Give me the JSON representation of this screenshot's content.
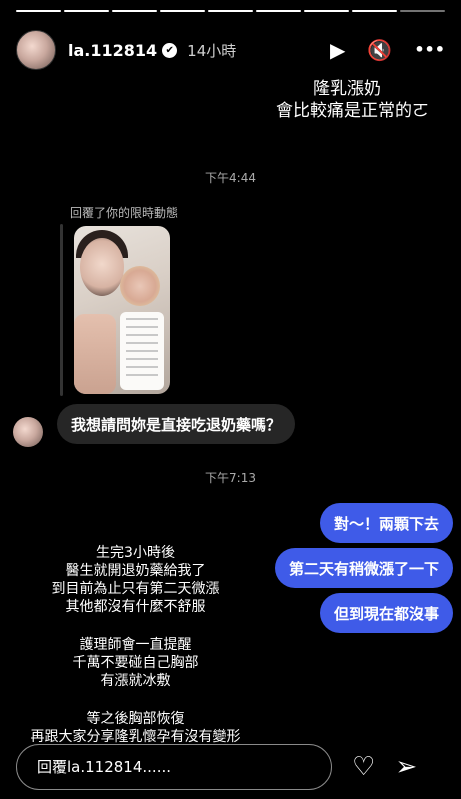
{
  "progress_segments": 9,
  "progress_done": 8,
  "header": {
    "username": "la.112814",
    "verified_glyph": "✔",
    "time": "14小時",
    "play_icon": "▶",
    "mute_icon": "🔇",
    "more_icon": "•••"
  },
  "story": {
    "top_line1": "隆乳漲奶",
    "top_line2": "會比較痛是正常的ㄛ",
    "timestamp1": "下午4:44",
    "reply_label": "回覆了你的限時動態",
    "gray_bubble": "我想請問妳是直接吃退奶藥嗎？",
    "timestamp2": "下午7:13",
    "blue_bubbles": [
      "對～！兩顆下去",
      "第二天有稍微漲了一下",
      "但到現在都沒事"
    ],
    "overlay_block1": [
      "生完3小時後",
      "醫生就開退奶藥給我了",
      "到目前為止只有第二天微漲",
      "其他都沒有什麼不舒服"
    ],
    "overlay_block2": [
      "護理師會一直提醒",
      "千萬不要碰自己胸部",
      "有漲就冰敷"
    ],
    "overlay_block3": [
      "等之後胸部恢復",
      "再跟大家分享隆乳懷孕有沒有變形"
    ]
  },
  "footer": {
    "reply_placeholder": "回覆la.112814......",
    "heart_icon": "♡",
    "send_icon": "➢"
  }
}
